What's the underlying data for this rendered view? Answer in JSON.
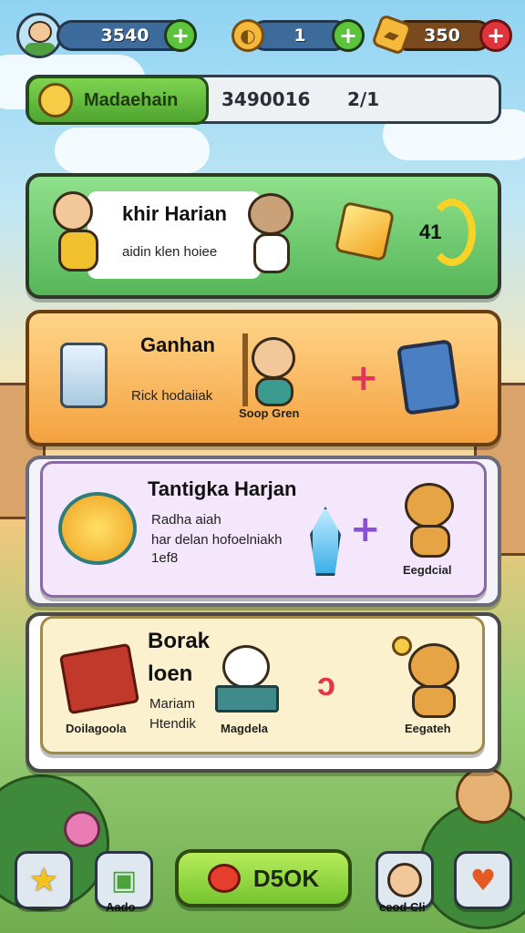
{
  "topbar": {
    "stat1_value": "3540",
    "stat2_value": "1",
    "stat3_value": "350"
  },
  "quest_bar": {
    "tab_label": "Madaehain",
    "score": "3490016",
    "progress": "2/1"
  },
  "cards": [
    {
      "title": "khir Harian",
      "subtitle": "aidin klen hoiee",
      "reward_value": "41"
    },
    {
      "title": "Ganhan",
      "subtitle": "Rick hodaiiak",
      "character_label": "Soop Gren"
    },
    {
      "title": "Tantigka Harjan",
      "subtitle_line1": "Radha aiah",
      "subtitle_line2": "har delan hofoelniakh",
      "subtitle_line3": "1ef8",
      "character_label": "Eegdcial"
    },
    {
      "title_line1": "Borak",
      "title_line2": "loen",
      "subtitle_line1": "Mariam",
      "subtitle_line2": "Htendik",
      "item1_label": "Doilagoola",
      "item2_label": "Magdela",
      "character_label": "Eegateh"
    }
  ],
  "bottom_nav": {
    "main_label": "D5OK",
    "left2_label": "Aado",
    "right1_label": "eeod Cli"
  },
  "icons": {
    "star": "star-icon",
    "apple": "apple-icon",
    "heart": "heart-icon",
    "plus": "plus-icon"
  },
  "colors": {
    "accent_green": "#5cc43a",
    "accent_red": "#e0343c",
    "card_green": "#57b65a",
    "card_orange": "#f4a23f",
    "card_purple": "#f4e6fb",
    "card_cream": "#fbf1cf"
  }
}
